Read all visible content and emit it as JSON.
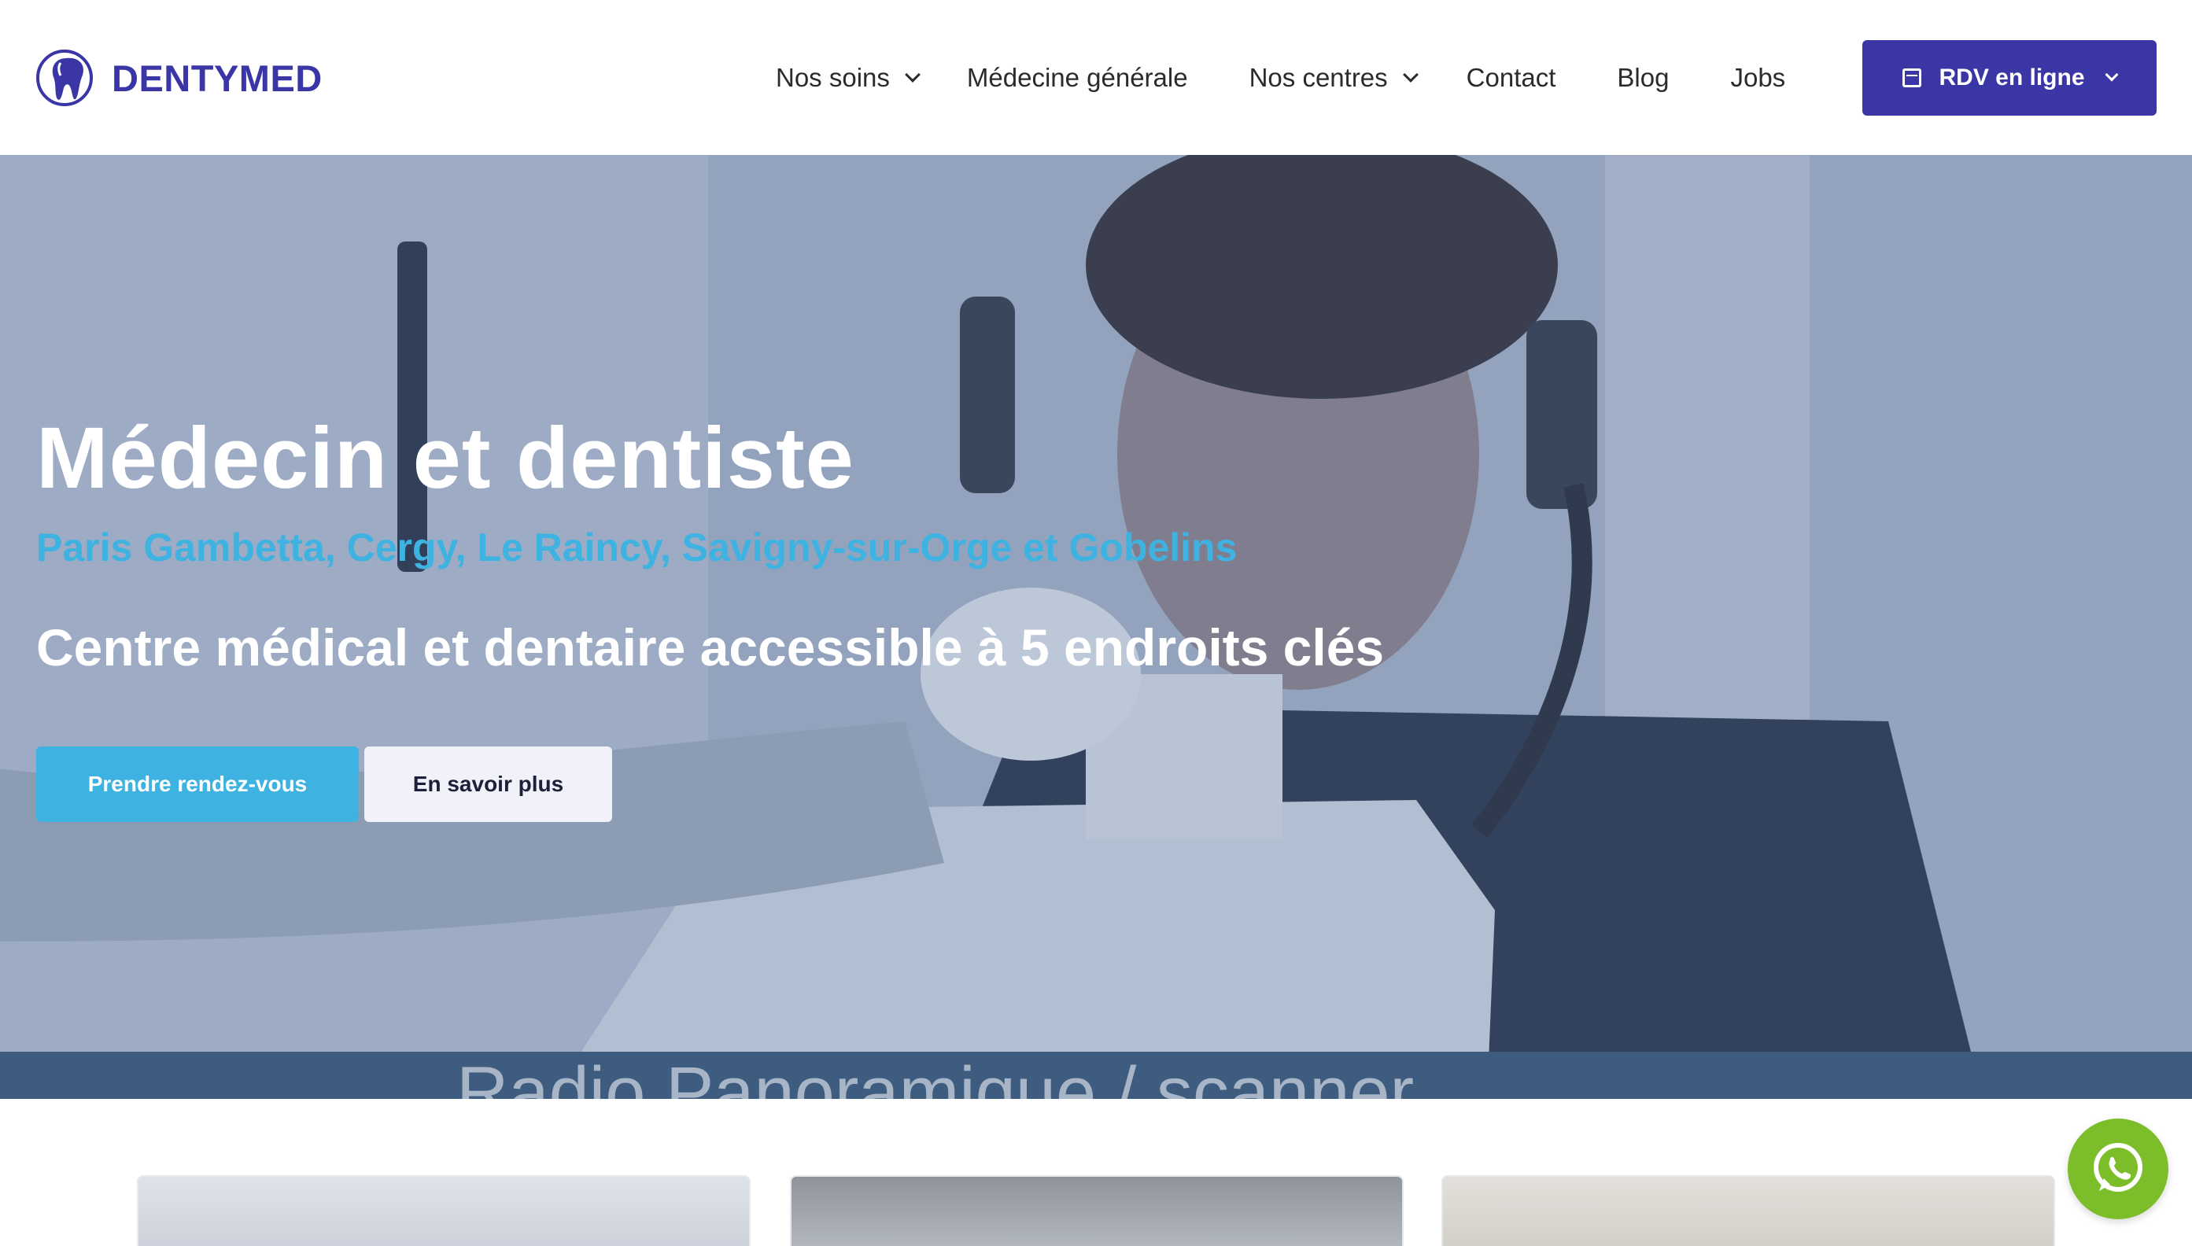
{
  "brand": {
    "name": "DENTYMED",
    "color": "#3b36a6"
  },
  "nav": {
    "items": [
      {
        "label": "Nos soins",
        "has_dropdown": true
      },
      {
        "label": "Médecine générale",
        "has_dropdown": false
      },
      {
        "label": "Nos centres",
        "has_dropdown": true
      },
      {
        "label": "Contact",
        "has_dropdown": false
      },
      {
        "label": "Blog",
        "has_dropdown": false
      },
      {
        "label": "Jobs",
        "has_dropdown": false
      }
    ],
    "cta": {
      "label": "RDV en ligne",
      "icon": "calendar-icon"
    }
  },
  "hero": {
    "title": "Médecin et dentiste",
    "locations": "Paris Gambetta, Cergy, Le Raincy, Savigny-sur-Orge et Gobelins",
    "tagline": "Centre médical et dentaire accessible à 5 endroits clés",
    "primary_button": "Prendre rendez-vous",
    "secondary_button": "En savoir plus",
    "video_caption": "Radio Panoramique / scanner"
  },
  "colors": {
    "accent": "#3eb2e0",
    "brand": "#3b36a6",
    "whatsapp": "#7cbd2a"
  },
  "floating": {
    "icon": "whatsapp-icon"
  }
}
